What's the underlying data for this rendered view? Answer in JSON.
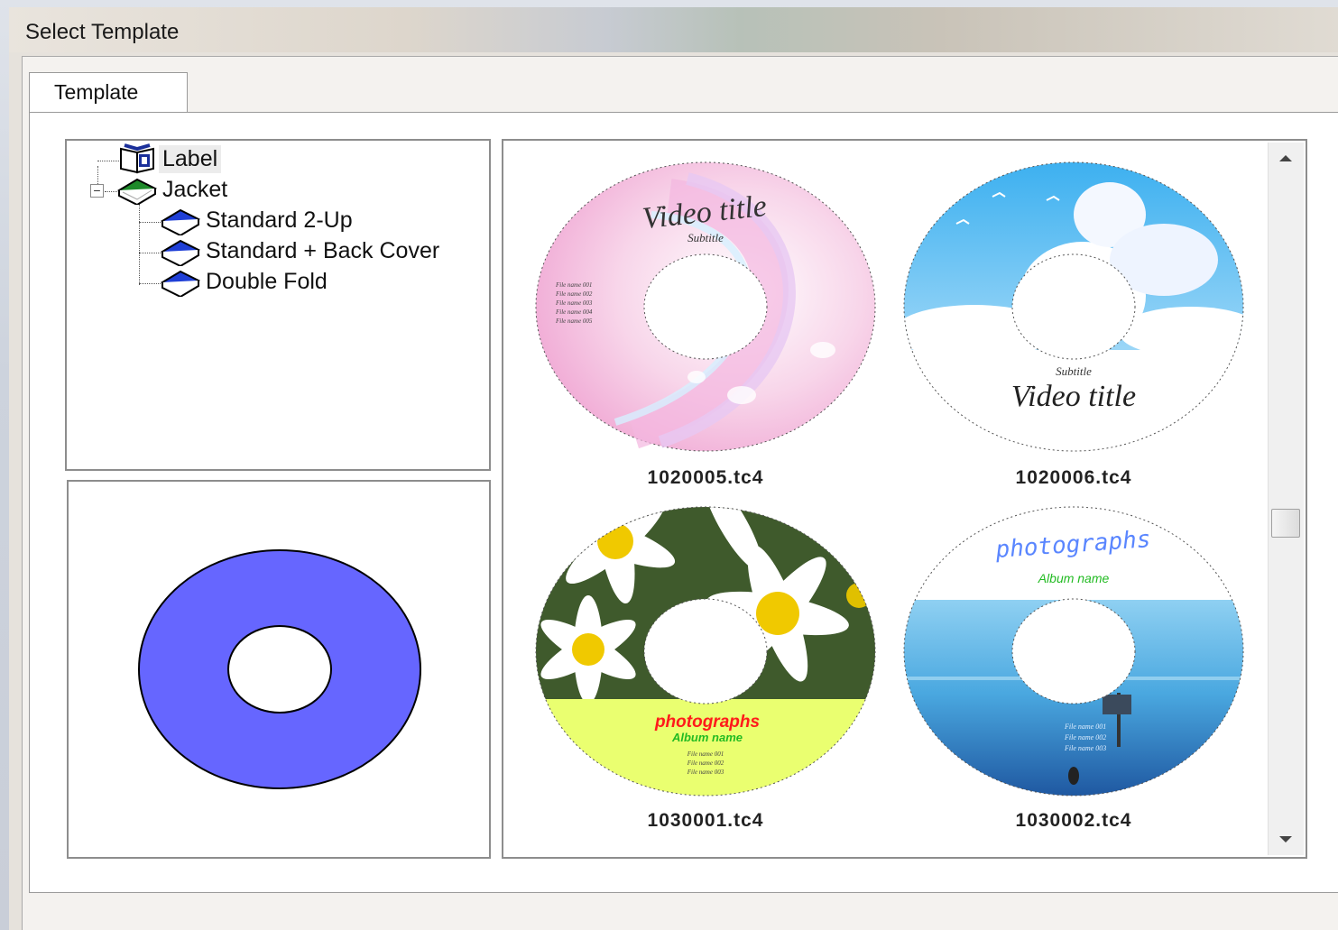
{
  "window": {
    "title": "Select Template"
  },
  "tabs": [
    {
      "label": "Template",
      "active": true
    }
  ],
  "tree": {
    "items": [
      {
        "label": "Label",
        "icon": "open-book-icon",
        "level": 0,
        "selected": true
      },
      {
        "label": "Jacket",
        "icon": "green-book-icon",
        "level": 0,
        "expanded": true
      },
      {
        "label": "Standard 2-Up",
        "icon": "blue-book-icon",
        "level": 1
      },
      {
        "label": "Standard + Back Cover",
        "icon": "blue-book-icon",
        "level": 1
      },
      {
        "label": "Double Fold",
        "icon": "blue-book-icon",
        "level": 1
      }
    ]
  },
  "preview": {
    "shape": "disc",
    "color": "#6666ff"
  },
  "templates": [
    {
      "file": "1020005.tc4",
      "title": "Video title",
      "subtitle": "Subtitle",
      "lines": [
        "File name 001",
        "File name 002",
        "File name 003",
        "File name 004",
        "File name 005"
      ]
    },
    {
      "file": "1020006.tc4",
      "title": "Video title",
      "subtitle": "Subtitle"
    },
    {
      "file": "1030001.tc4",
      "title": "photographs",
      "subtitle": "Album name",
      "lines": [
        "File name 001",
        "File name 002",
        "File name 003"
      ]
    },
    {
      "file": "1030002.tc4",
      "title": "photographs",
      "subtitle": "Album name",
      "lines": [
        "File name 001",
        "File name 002",
        "File name 003"
      ]
    }
  ],
  "colors": {
    "preview_disc": "#6666ff",
    "jacket_icon": "#1e8a2a",
    "book_icon": "#1f3fd6",
    "photo_title_red": "#ff1a1a",
    "album_name_green": "#22bb22",
    "photographs_blue": "#5a86ff"
  }
}
